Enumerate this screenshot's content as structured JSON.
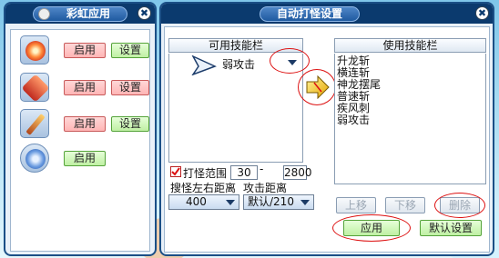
{
  "left_panel": {
    "title": "彩虹应用",
    "close_glyph": "✖",
    "apps": [
      {
        "icon": "flame-star-icon",
        "color": "#e85a2a",
        "enable_label": "启用",
        "settings_label": "设置",
        "settings_green": true
      },
      {
        "icon": "red-crystal-icon",
        "color": "#d4342a",
        "enable_label": "启用",
        "settings_label": "设置",
        "settings_green": false
      },
      {
        "icon": "sword-icon",
        "color": "#c8702c",
        "enable_label": "启用",
        "settings_label": "设置",
        "settings_green": true
      },
      {
        "icon": "blue-shield-icon",
        "color": "#3b6fc9",
        "enable_label": "启用"
      }
    ]
  },
  "right_panel": {
    "title": "自动打怪设置",
    "close_glyph": "✖",
    "available_header": "可用技能栏",
    "used_header": "使用技能栏",
    "available_selected": "弱攻击",
    "used_skills": [
      "升龙斩",
      "横连斩",
      "神龙摆尾",
      "普速斩",
      "疾风刺",
      "弱攻击"
    ],
    "range_label": "打怪范围",
    "range_checked": true,
    "range_from": "30",
    "range_dash": "-",
    "range_to": "2800",
    "search_distance_label": "搜怪左右距离",
    "attack_distance_label": "攻击距离",
    "search_distance_value": "400",
    "attack_distance_value": "默认/210",
    "move_up_label": "上移",
    "move_down_label": "下移",
    "delete_label": "删除",
    "apply_label": "应用",
    "default_label": "默认设置"
  }
}
